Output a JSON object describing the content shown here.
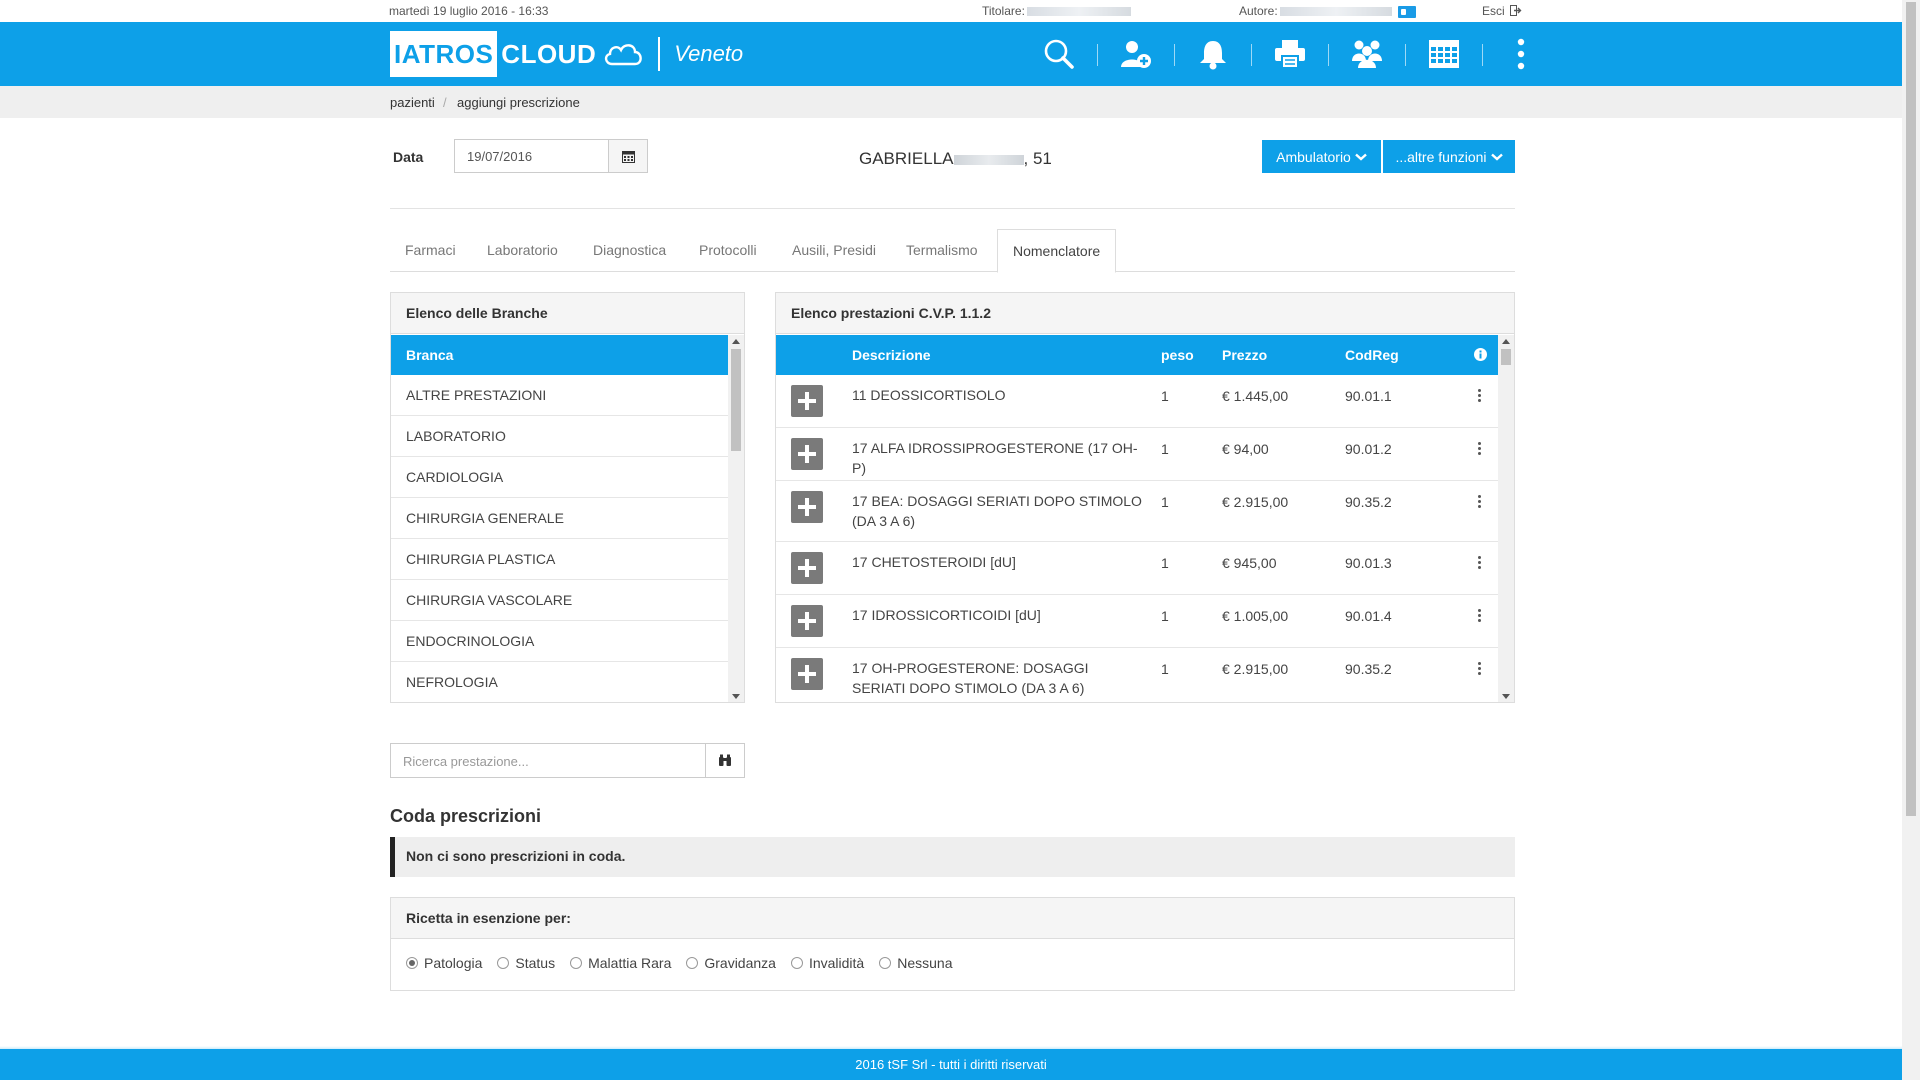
{
  "topbar": {
    "datetime": "martedì 19 luglio 2016 - 16:33",
    "titolare_label": "Titolare:",
    "autore_label": "Autore:",
    "esci_label": "Esci"
  },
  "header": {
    "logo_part1": "IATROS",
    "logo_part2": "CLOUD",
    "region": "Veneto",
    "icons": [
      "search-icon",
      "add-user-icon",
      "bell-icon",
      "print-icon",
      "group-icon",
      "calendar-icon",
      "more-vertical-icon"
    ],
    "brand_color": "#0da0e8"
  },
  "breadcrumb": {
    "item1": "pazienti",
    "separator": "/",
    "item2": "aggiungi prescrizione"
  },
  "form": {
    "date_label": "Data",
    "date_value": "19/07/2016",
    "patient_name": "GABRIELLA",
    "patient_age": ", 51",
    "ambulatorio_button": "Ambulatorio",
    "altre_funzioni_button": "...altre funzioni"
  },
  "tabs": [
    {
      "label": "Farmaci"
    },
    {
      "label": "Laboratorio"
    },
    {
      "label": "Diagnostica"
    },
    {
      "label": "Protocolli"
    },
    {
      "label": "Ausili, Presidi"
    },
    {
      "label": "Termalismo"
    },
    {
      "label": "Nomenclatore",
      "active": true
    }
  ],
  "branche": {
    "title": "Elenco delle Branche",
    "header": "Branca",
    "items": [
      "ALTRE PRESTAZIONI",
      "LABORATORIO",
      "CARDIOLOGIA",
      "CHIRURGIA GENERALE",
      "CHIRURGIA PLASTICA",
      "CHIRURGIA VASCOLARE",
      "ENDOCRINOLOGIA",
      "NEFROLOGIA"
    ]
  },
  "prestazioni": {
    "title": "Elenco prestazioni C.V.P. 1.1.2",
    "columns": {
      "descrizione": "Descrizione",
      "peso": "peso",
      "prezzo": "Prezzo",
      "codreg": "CodReg"
    },
    "rows": [
      {
        "descrizione": "11 DEOSSICORTISOLO",
        "peso": "1",
        "prezzo": "€ 1.445,00",
        "codreg": "90.01.1"
      },
      {
        "descrizione": "17 ALFA IDROSSIPROGESTERONE (17 OH-P)",
        "peso": "1",
        "prezzo": "€ 94,00",
        "codreg": "90.01.2"
      },
      {
        "descrizione": "17 BEA: DOSAGGI SERIATI DOPO STIMOLO (DA 3 A 6)",
        "peso": "1",
        "prezzo": "€ 2.915,00",
        "codreg": "90.35.2"
      },
      {
        "descrizione": "17 CHETOSTEROIDI [dU]",
        "peso": "1",
        "prezzo": "€ 945,00",
        "codreg": "90.01.3"
      },
      {
        "descrizione": "17 IDROSSICORTICOIDI [dU]",
        "peso": "1",
        "prezzo": "€ 1.005,00",
        "codreg": "90.01.4"
      },
      {
        "descrizione": "17 OH-PROGESTERONE: DOSAGGI SERIATI DOPO STIMOLO (DA 3 A 6)",
        "peso": "1",
        "prezzo": "€ 2.915,00",
        "codreg": "90.35.2"
      }
    ]
  },
  "search": {
    "placeholder": "Ricerca prestazione..."
  },
  "coda": {
    "title": "Coda prescrizioni",
    "empty_message": "Non ci sono prescrizioni in coda."
  },
  "esenzione": {
    "title": "Ricetta in esenzione per:",
    "options": [
      "Patologia",
      "Status",
      "Malattia Rara",
      "Gravidanza",
      "Invalidità",
      "Nessuna"
    ],
    "selected": "Patologia"
  },
  "footer": {
    "text": "2016 tSF Srl - tutti i diritti riservati"
  }
}
